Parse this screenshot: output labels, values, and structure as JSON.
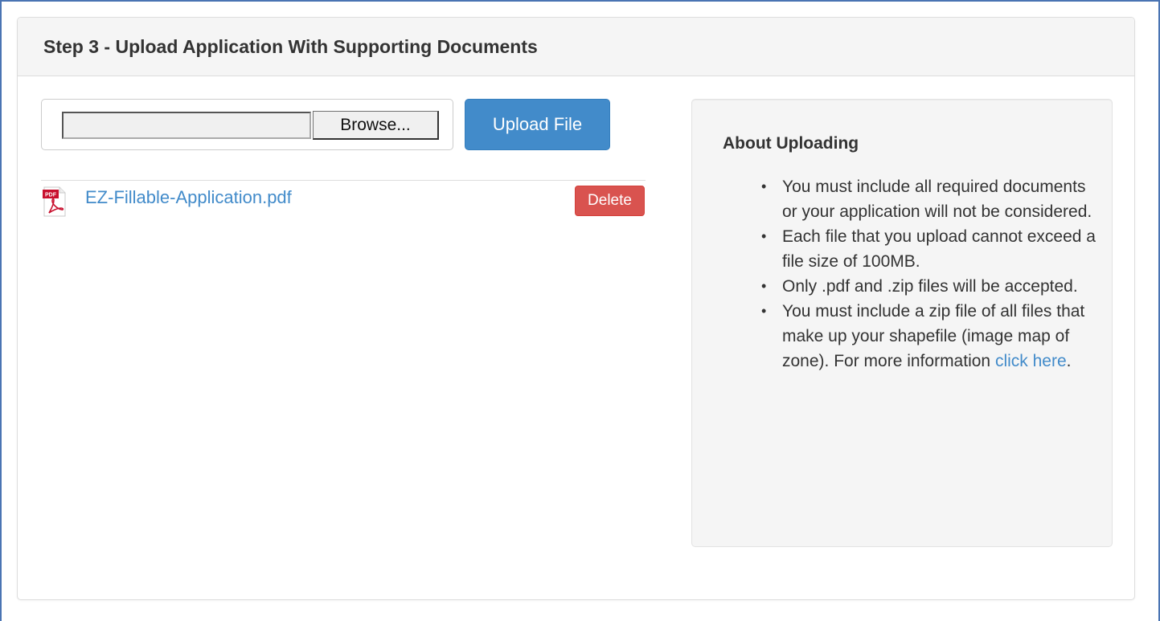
{
  "panel": {
    "title": "Step 3 - Upload Application With Supporting Documents"
  },
  "uploader": {
    "file_value": "",
    "browse_label": "Browse...",
    "upload_label": "Upload File"
  },
  "files": [
    {
      "name": "EZ-Fillable-Application.pdf",
      "icon": "pdf-file-icon",
      "delete_label": "Delete"
    }
  ],
  "about": {
    "title": "About Uploading",
    "items": [
      "You must include all required documents or your application will not be considered.",
      "Each file that you upload cannot exceed a file size of 100MB.",
      "Only .pdf and .zip files will be accepted."
    ],
    "last_item_text": "You must include a zip file of all files that make up your shapefile (image map of zone). For more information ",
    "last_item_link": "click here",
    "last_item_suffix": "."
  },
  "colors": {
    "primary": "#428bca",
    "danger": "#d9534f",
    "frame": "#4a74b3"
  }
}
